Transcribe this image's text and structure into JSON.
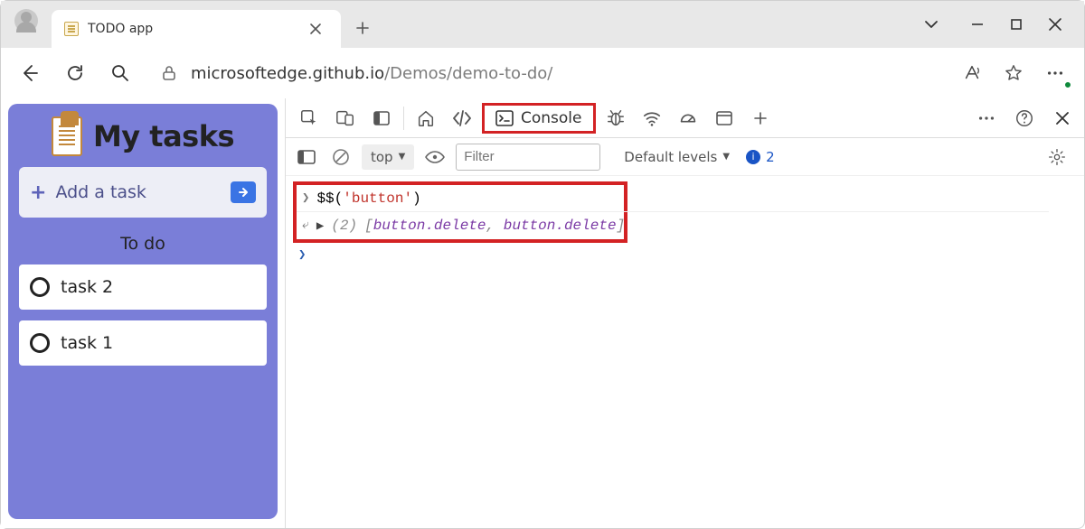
{
  "tab": {
    "title": "TODO app"
  },
  "url": {
    "host": "microsoftedge.github.io",
    "path": "/Demos/demo-to-do/"
  },
  "app": {
    "title": "My tasks",
    "add_placeholder": "Add a task",
    "section": "To do",
    "tasks": [
      "task 2",
      "task 1"
    ]
  },
  "devtools": {
    "active_tab": "Console",
    "filter": {
      "context": "top",
      "placeholder": "Filter",
      "levels": "Default levels",
      "issues_count": "2"
    },
    "console": {
      "input_prefix": "$$(",
      "input_arg": "'button'",
      "input_suffix": ")",
      "output_count": "(2)",
      "output_open": "[",
      "output_item1": "button.delete",
      "output_sep": ", ",
      "output_item2": "button.delete",
      "output_close": "]"
    }
  }
}
